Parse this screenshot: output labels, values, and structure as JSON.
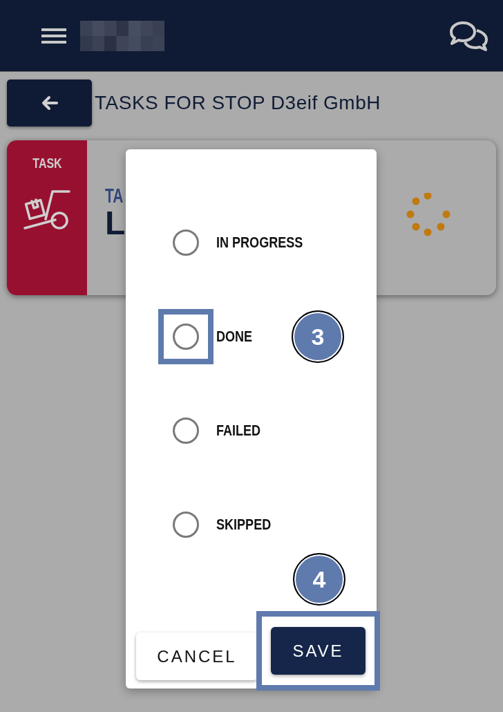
{
  "page": {
    "title": "TASKS FOR STOP D3eif GmbH"
  },
  "task_card": {
    "badge": "TASK",
    "line_1": "TA",
    "line_2": "L"
  },
  "dialog": {
    "options": [
      {
        "label": "IN PROGRESS",
        "selected": false,
        "highlighted": false
      },
      {
        "label": "DONE",
        "selected": false,
        "highlighted": true,
        "step": "3"
      },
      {
        "label": "FAILED",
        "selected": false,
        "highlighted": false
      },
      {
        "label": "SKIPPED",
        "selected": false,
        "highlighted": false
      }
    ],
    "buttons": [
      {
        "label": "CANCEL",
        "kind": "secondary",
        "highlighted": false
      },
      {
        "label": "SAVE",
        "kind": "primary",
        "highlighted": true,
        "step": "4"
      }
    ]
  }
}
